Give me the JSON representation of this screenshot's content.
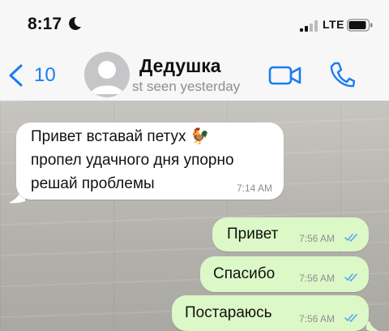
{
  "status_bar": {
    "time": "8:17",
    "network": "LTE",
    "icons": [
      "moon-icon",
      "signal-icon",
      "battery-icon"
    ]
  },
  "header": {
    "back_count": "10",
    "contact_name": "Дедушка",
    "contact_status": "st seen yesterday",
    "icons": [
      "chevron-left-icon",
      "avatar-placeholder",
      "video-camera-icon",
      "phone-icon"
    ],
    "accent_color": "#1a7cf5"
  },
  "messages": [
    {
      "direction": "incoming",
      "lines": [
        "Привет вставай петух 🐓",
        "пропел удачного дня упорно",
        "решай проблемы"
      ],
      "time": "7:14 AM"
    },
    {
      "direction": "outgoing",
      "text": "Привет",
      "time": "7:56 AM",
      "status": "read-double-check"
    },
    {
      "direction": "outgoing",
      "text": "Спасибо",
      "time": "7:56 AM",
      "status": "read-double-check"
    },
    {
      "direction": "outgoing",
      "text": "Постараюсь",
      "time": "7:56 AM",
      "status": "read-double-check"
    }
  ],
  "colors": {
    "incoming_bubble": "#ffffff",
    "outgoing_bubble": "#dcf8c6",
    "read_ticks": "#4fa3f7"
  }
}
